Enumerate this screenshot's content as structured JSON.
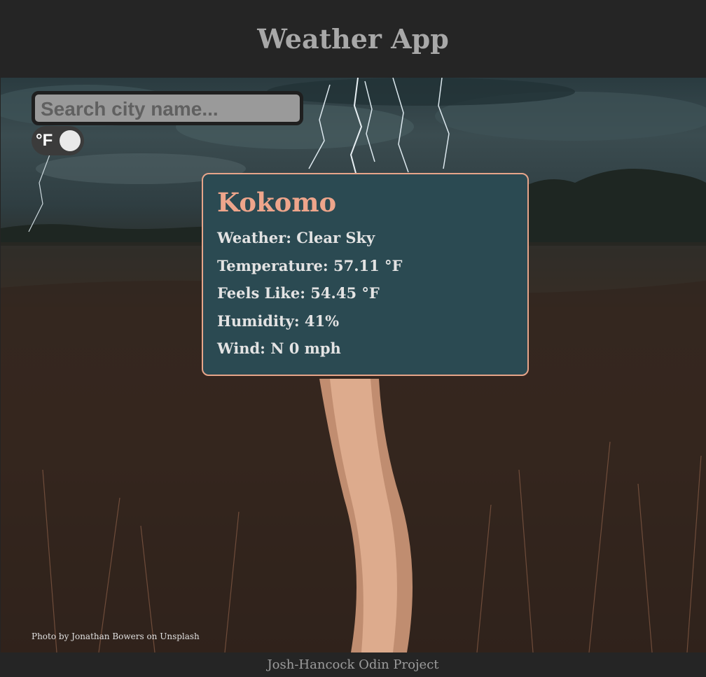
{
  "header": {
    "title": "Weather App"
  },
  "search": {
    "placeholder": "Search city name...",
    "value": ""
  },
  "unit_toggle": {
    "label": "°F",
    "state": "fahrenheit"
  },
  "weather_card": {
    "city": "Kokomo",
    "rows": [
      "Weather: Clear Sky",
      "Temperature: 57.11 °F",
      "Feels Like: 54.45 °F",
      "Humidity: 41%",
      "Wind: N 0 mph"
    ]
  },
  "background": {
    "credit": "Photo by Jonathan Bowers on Unsplash"
  },
  "footer": {
    "text": "Josh-Hancock Odin Project"
  },
  "colors": {
    "header_bg": "#252525",
    "card_bg": "#2b4a52",
    "card_border": "#e7a58a",
    "city_color": "#eea58b"
  }
}
